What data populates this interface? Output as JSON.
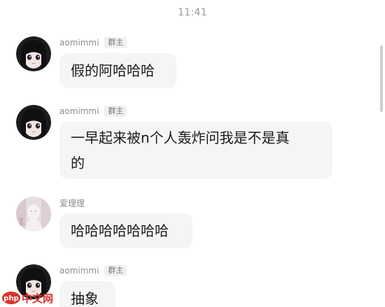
{
  "header": {
    "time": "11:41"
  },
  "messages": [
    {
      "sender": "aomimmi",
      "badge": "群主",
      "text": "假的阿哈哈哈",
      "avatar": "dark-hair-girl-avatar"
    },
    {
      "sender": "aomimmi",
      "badge": "群主",
      "text_line1": "一早起来被n个人轰炸问我是不是真",
      "text_line2": "的",
      "avatar": "dark-hair-girl-avatar"
    },
    {
      "sender": "爱理理",
      "text": "哈哈哈哈哈哈哈",
      "avatar": "pale-figure-avatar"
    },
    {
      "sender": "aomimmi",
      "badge": "群主",
      "text": "抽象",
      "avatar": "dark-hair-girl-avatar"
    }
  ],
  "watermark": {
    "text": "php中文网"
  },
  "colors": {
    "background": "#ffffff",
    "bubble": "#f5f5f5",
    "badge_bg": "#f0f0f0",
    "meta_text": "#8c8c8c",
    "watermark_red": "#d8342c"
  }
}
